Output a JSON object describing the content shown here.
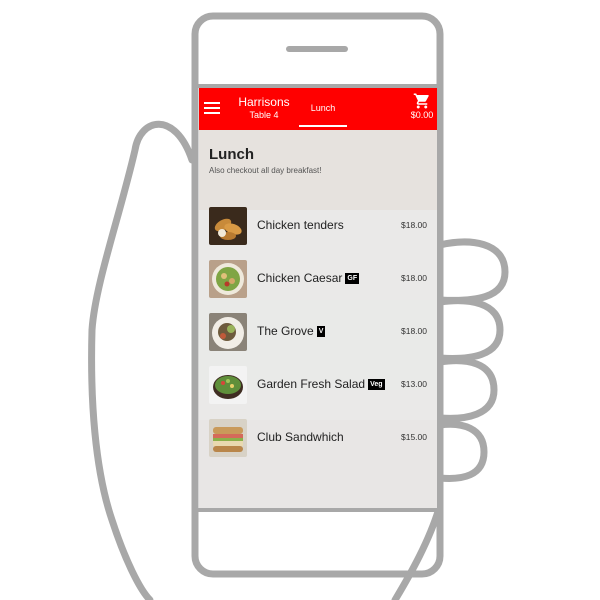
{
  "header": {
    "restaurant": "Harrisons",
    "table": "Table 4",
    "tab_label": "Lunch",
    "cart_total": "$0.00",
    "icons": {
      "menu": "hamburger-menu-icon",
      "cart": "shopping-cart-icon"
    },
    "accent_color": "#ff0000"
  },
  "section": {
    "title": "Lunch",
    "subtitle": "Also checkout all day breakfast!"
  },
  "items": [
    {
      "name": "Chicken tenders",
      "badge": "",
      "price": "$18.00"
    },
    {
      "name": "Chicken Caesar",
      "badge": "GF",
      "price": "$18.00"
    },
    {
      "name": "The Grove",
      "badge": "V",
      "price": "$18.00"
    },
    {
      "name": "Garden Fresh Salad",
      "badge": "Veg",
      "price": "$13.00"
    },
    {
      "name": "Club Sandwhich",
      "badge": "",
      "price": "$15.00"
    }
  ]
}
